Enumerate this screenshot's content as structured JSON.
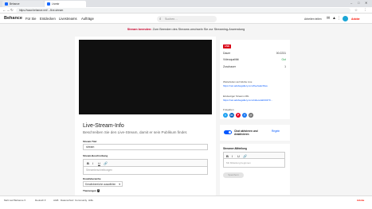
{
  "browser": {
    "tabs": [
      {
        "label": "Behance",
        "favicon_color": "#1769ff"
      },
      {
        "label": "Livestr",
        "favicon_color": "#1769ff"
      }
    ],
    "url": "https://www.behance.net/…/live-stream",
    "window_controls": [
      "–",
      "□",
      "✕"
    ]
  },
  "header": {
    "logo": "Behance",
    "nav": [
      "Für Sie",
      "Entdecken",
      "Livestreams",
      "Aufträge"
    ],
    "search_placeholder": "Suchen…",
    "right_link": "Arbeiten teilen",
    "adobe": "Adobe"
  },
  "banner": {
    "bold": "Stream beenden:",
    "text": " Zum Beenden des Streams wechseln Sie zur Streaming-Anwendung"
  },
  "main": {
    "title": "Live-Stream-Info",
    "subtitle": "Beschreiben Sie den Live-Stream, damit er sein Publikum findet.",
    "title_label": "Stream-Titel",
    "title_value": "stream",
    "desc_label": "Stream-Beschreibung",
    "toolbar": [
      "B",
      "I",
      "U",
      "🔗"
    ],
    "desc_placeholder": "Streambeschreibungen",
    "category_label": "Kreativbereiche",
    "category_value": "Kreativbereiche auswählen",
    "tags_label": "Themengen",
    "info": "i"
  },
  "panel": {
    "live_badge": "LIVE",
    "rows": [
      {
        "key": "Dauer",
        "value": "00:2231"
      },
      {
        "key": "Videoqualität",
        "value": "Gut"
      },
      {
        "key": "Zuschauer",
        "value": "1"
      }
    ],
    "permalink_label": "Weiterleiten auf Adobe Live",
    "permalink": "https://net.adobegallery.com/live/watchlive",
    "embed_label": "Eindeutiger Stream-URL",
    "embed": "https://net.adobegallery.com/videos/abb0470…",
    "share_label": "Freigeben",
    "share_icons": [
      {
        "name": "twitter-icon",
        "glyph": "t",
        "color": "#1da1f2"
      },
      {
        "name": "linkedin-icon",
        "glyph": "in",
        "color": "#0a66c2"
      },
      {
        "name": "pinterest-icon",
        "glyph": "P",
        "color": "#e60023"
      },
      {
        "name": "facebook-icon",
        "glyph": "f",
        "color": "#1877f2"
      },
      {
        "name": "email-icon",
        "glyph": "@",
        "color": "#666666"
      }
    ]
  },
  "chat": {
    "toggle_label": "Chat aktivieren und deaktivieren",
    "link": "Regeln"
  },
  "message": {
    "label": "Streamer-Mitteilung",
    "toolbar": [
      "B",
      "I",
      "U",
      "🔗"
    ],
    "placeholder": "Mit Mitteilung beginnen",
    "save": "Speichern"
  },
  "statusbar": {
    "items": [
      "Mehr auf Behance ▾",
      "Deutsch ▾",
      "AGB",
      "Datenschutz",
      "Community",
      "Hilfe"
    ],
    "right": "Adobe"
  }
}
